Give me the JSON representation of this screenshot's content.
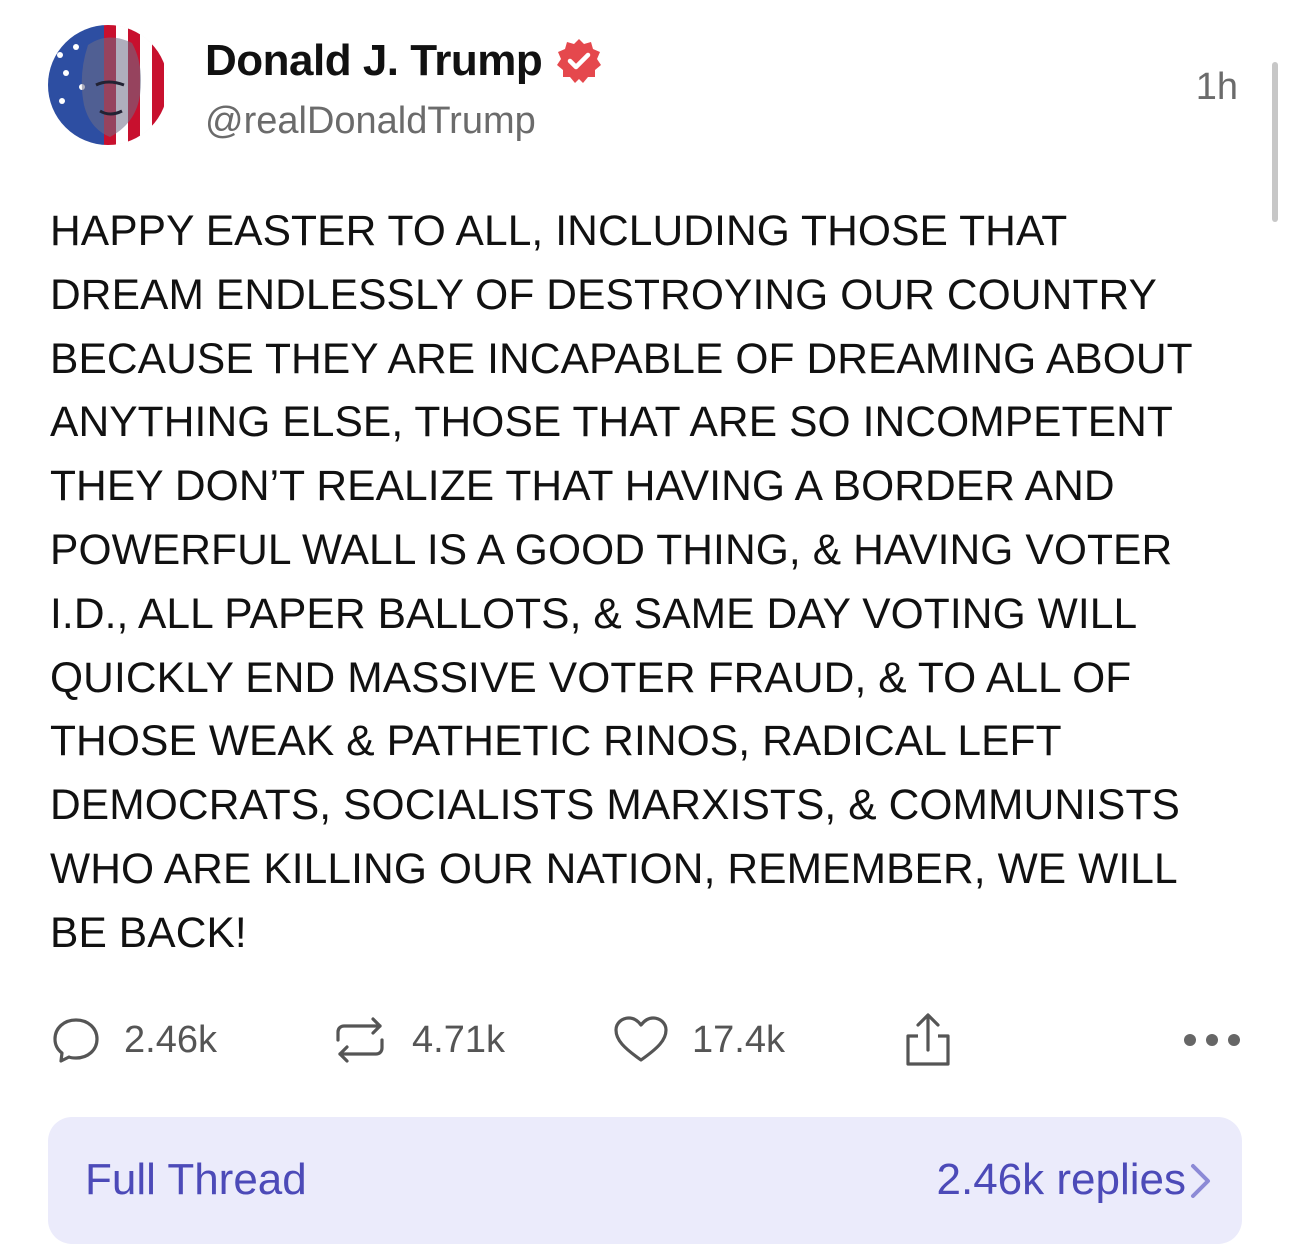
{
  "author": {
    "display_name": "Donald J. Trump",
    "handle": "@realDonaldTrump",
    "verified": true
  },
  "timestamp": "1h",
  "post": {
    "text": "HAPPY EASTER TO ALL, INCLUDING THOSE THAT\nDREAM ENDLESSLY OF DESTROYING OUR COUNTRY\nBECAUSE THEY ARE INCAPABLE OF DREAMING ABOUT\nANYTHING ELSE, THOSE THAT ARE SO INCOMPETENT\nTHEY DON’T REALIZE THAT HAVING A BORDER AND\nPOWERFUL WALL IS A GOOD THING, & HAVING VOTER\nI.D., ALL PAPER BALLOTS, & SAME DAY VOTING WILL\nQUICKLY END MASSIVE VOTER FRAUD, & TO ALL OF\nTHOSE WEAK & PATHETIC RINOS, RADICAL LEFT\nDEMOCRATS, SOCIALISTS MARXISTS, & COMMUNISTS\nWHO ARE KILLING OUR NATION, REMEMBER, WE WILL\nBE BACK!"
  },
  "actions": {
    "replies": "2.46k",
    "reposts": "4.71k",
    "likes": "17.4k",
    "icons": [
      "reply-icon",
      "repost-icon",
      "like-icon",
      "share-icon",
      "more-icon"
    ]
  },
  "thread": {
    "label": "Full Thread",
    "replies_label": "2.46k replies"
  },
  "colors": {
    "accent": "#4c4ab8",
    "thread_bg": "#ebebfb",
    "verified": "#e5484d",
    "muted": "#6b6b6b"
  }
}
